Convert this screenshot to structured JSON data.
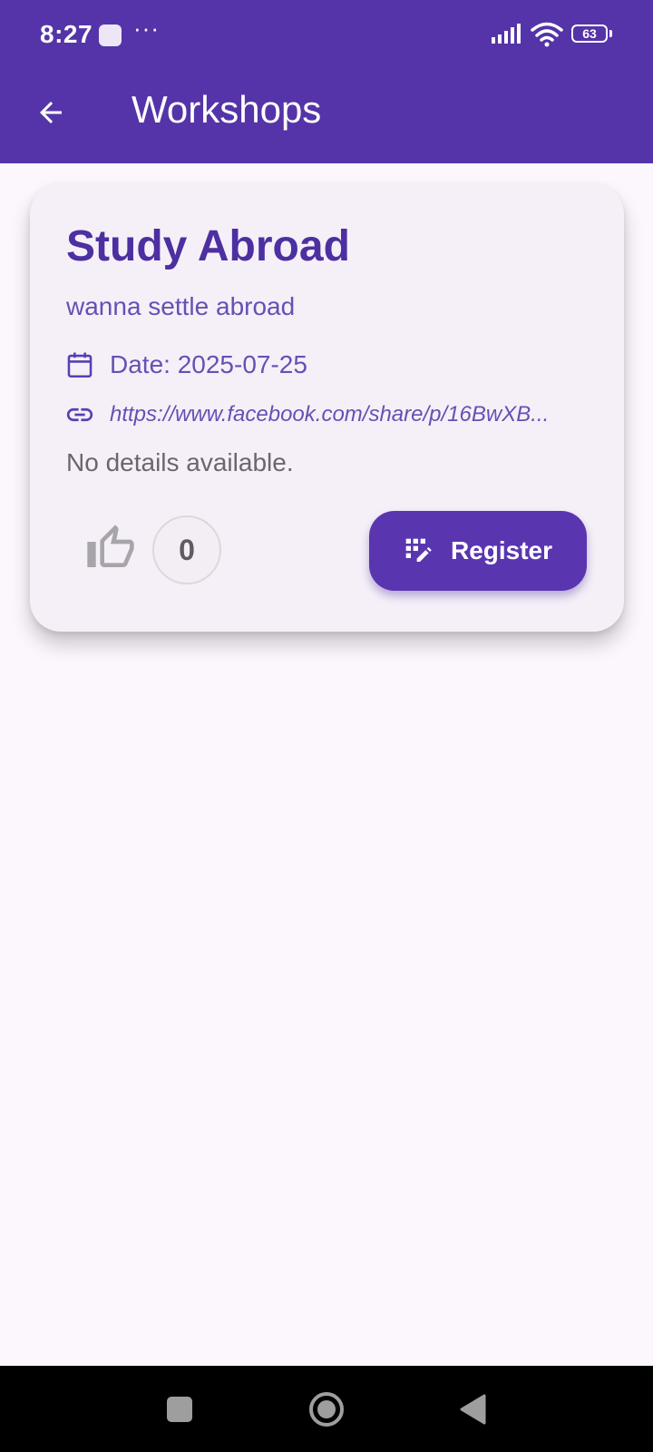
{
  "status_bar": {
    "time": "8:27",
    "more": "···",
    "battery_level": "63"
  },
  "app_bar": {
    "title": "Workshops",
    "back_icon": "arrow-back-icon",
    "background_color": "#5434a8"
  },
  "workshop": {
    "title": "Study Abroad",
    "subtitle": "wanna settle abroad",
    "date": "Date: 2025-07-25",
    "link": "https://www.facebook.com/share/p/16BwXB...",
    "details": "No details available.",
    "likes": "0",
    "register_label": "Register",
    "like_icon": "thumb-up-icon",
    "register_icon": "app-registration-icon",
    "date_icon": "calendar-icon",
    "link_icon": "link-icon"
  },
  "nav_bar": {
    "recents_icon": "square-icon",
    "home_icon": "circle-icon",
    "back_icon": "triangle-back-icon"
  }
}
